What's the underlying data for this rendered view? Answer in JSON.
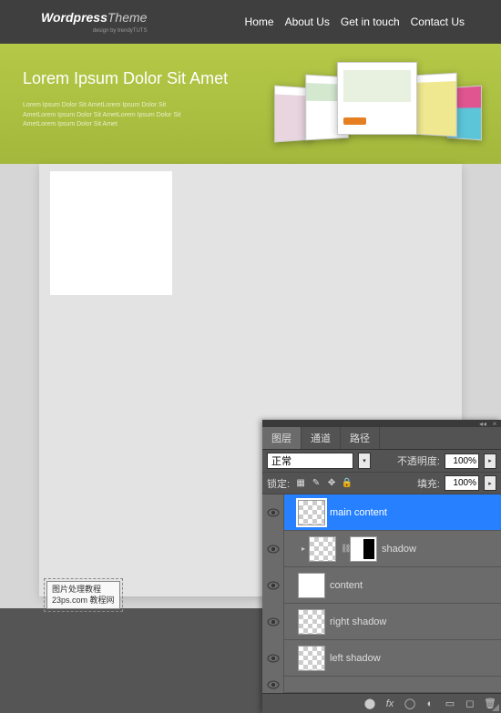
{
  "header": {
    "logo_main": "Wordpress",
    "logo_light": "Theme",
    "logo_sub": "design by trendyTUTS",
    "nav": [
      "Home",
      "About Us",
      "Get in touch",
      "Contact Us"
    ]
  },
  "hero": {
    "title": "Lorem Ipsum Dolor Sit Amet",
    "text": "Lorem Ipsum Dolor Sit AmetLorem Ipsum Dolor Sit\nAmetLorem Ipsum Dolor Sit AmetLorem Ipsum Dolor Sit\nAmetLorem Ipsum Dolor Sit Amet"
  },
  "watermark": {
    "line1": "图片处理教程",
    "line2": "23ps.com 教程网"
  },
  "panel": {
    "tabs": [
      "图层",
      "通道",
      "路径"
    ],
    "blend_row": {
      "mode": "正常",
      "opacity_label": "不透明度:",
      "opacity": "100%"
    },
    "lock_row": {
      "label": "锁定:",
      "fill_label": "填充:",
      "fill": "100%"
    },
    "layers": [
      {
        "name": "main content",
        "selected": true,
        "mask": false
      },
      {
        "name": "shadow",
        "selected": false,
        "mask": "black"
      },
      {
        "name": "content",
        "selected": false,
        "mask": false
      },
      {
        "name": "right shadow",
        "selected": false,
        "mask": false
      },
      {
        "name": "left shadow",
        "selected": false,
        "mask": false
      }
    ]
  }
}
